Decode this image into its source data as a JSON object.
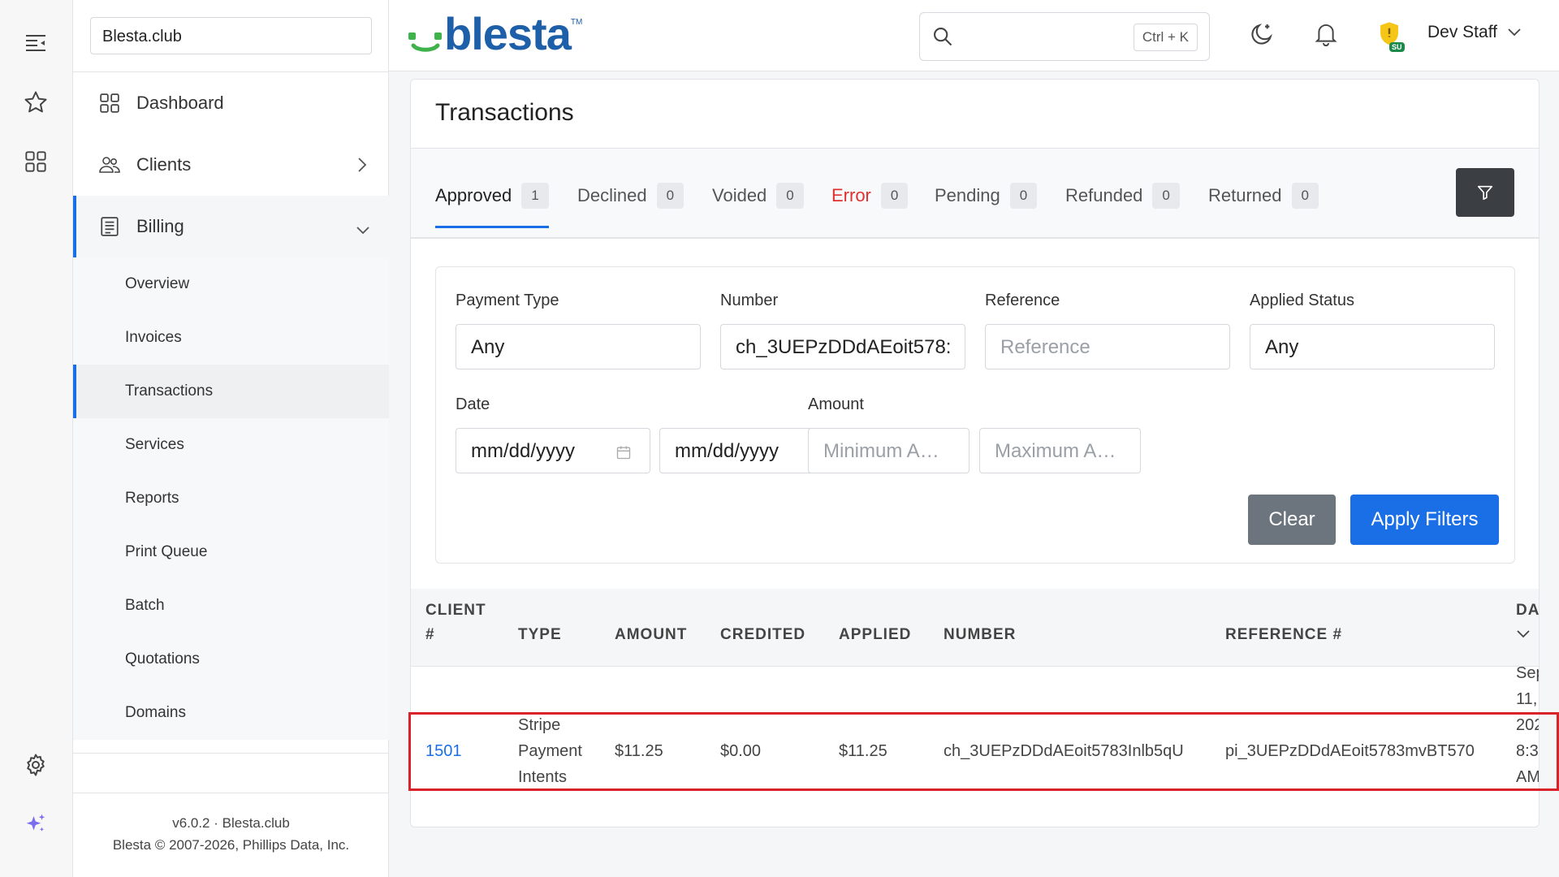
{
  "sidebar": {
    "site": "Blesta.club",
    "nav": [
      {
        "label": "Dashboard"
      },
      {
        "label": "Clients"
      },
      {
        "label": "Billing"
      }
    ],
    "billing_items": [
      {
        "label": "Overview"
      },
      {
        "label": "Invoices"
      },
      {
        "label": "Transactions"
      },
      {
        "label": "Services"
      },
      {
        "label": "Reports"
      },
      {
        "label": "Print Queue"
      },
      {
        "label": "Batch"
      },
      {
        "label": "Quotations"
      },
      {
        "label": "Domains"
      }
    ],
    "footer_version": "v6.0.2 · Blesta.club",
    "footer_copyright": "Blesta © 2007-2026, Phillips Data, Inc."
  },
  "header": {
    "logo_text": "blesta",
    "logo_tm": "TM",
    "search_placeholder": "",
    "search_shortcut": "Ctrl + K",
    "badge": "SU",
    "user": "Dev Staff"
  },
  "page": {
    "title": "Transactions",
    "tabs": [
      {
        "label": "Approved",
        "count": "1"
      },
      {
        "label": "Declined",
        "count": "0"
      },
      {
        "label": "Voided",
        "count": "0"
      },
      {
        "label": "Error",
        "count": "0"
      },
      {
        "label": "Pending",
        "count": "0"
      },
      {
        "label": "Refunded",
        "count": "0"
      },
      {
        "label": "Returned",
        "count": "0"
      }
    ]
  },
  "filters": {
    "payment_type_label": "Payment Type",
    "payment_type_value": "Any",
    "number_label": "Number",
    "number_value": "ch_3UEPzDDdAEoit578:",
    "reference_label": "Reference",
    "reference_placeholder": "Reference",
    "applied_status_label": "Applied Status",
    "applied_status_value": "Any",
    "date_label": "Date",
    "date_from_placeholder": "mm/dd/yyyy",
    "date_to_placeholder": "mm/dd/yyyy",
    "amount_label": "Amount",
    "amount_min_placeholder": "Minimum A…",
    "amount_max_placeholder": "Maximum A…",
    "clear_label": "Clear",
    "apply_label": "Apply Filters"
  },
  "table": {
    "headers": {
      "client_1": "CLIENT",
      "client_2": "#",
      "type": "TYPE",
      "amount": "AMOUNT",
      "credited": "CREDITED",
      "applied": "APPLIED",
      "number": "NUMBER",
      "reference": "REFERENCE #",
      "date": "DA"
    },
    "rows": [
      {
        "client": "1501",
        "type_1": "Stripe",
        "type_2": "Payment",
        "type_3": "Intents",
        "amount": "$11.25",
        "credited": "$0.00",
        "applied": "$11.25",
        "number": "ch_3UEPzDDdAEoit5783Inlb5qU",
        "reference": "pi_3UEPzDDdAEoit5783mvBT570",
        "date_1": "Sep",
        "date_2": "11,",
        "date_3": "202",
        "date_4": "8:3",
        "date_5": "AM"
      }
    ]
  },
  "colors": {
    "accent": "#1a6fe6",
    "error": "#e03131",
    "highlight": "#d9222a",
    "logo": "#1d5fa8",
    "logo_smile": "#3fb24c"
  }
}
